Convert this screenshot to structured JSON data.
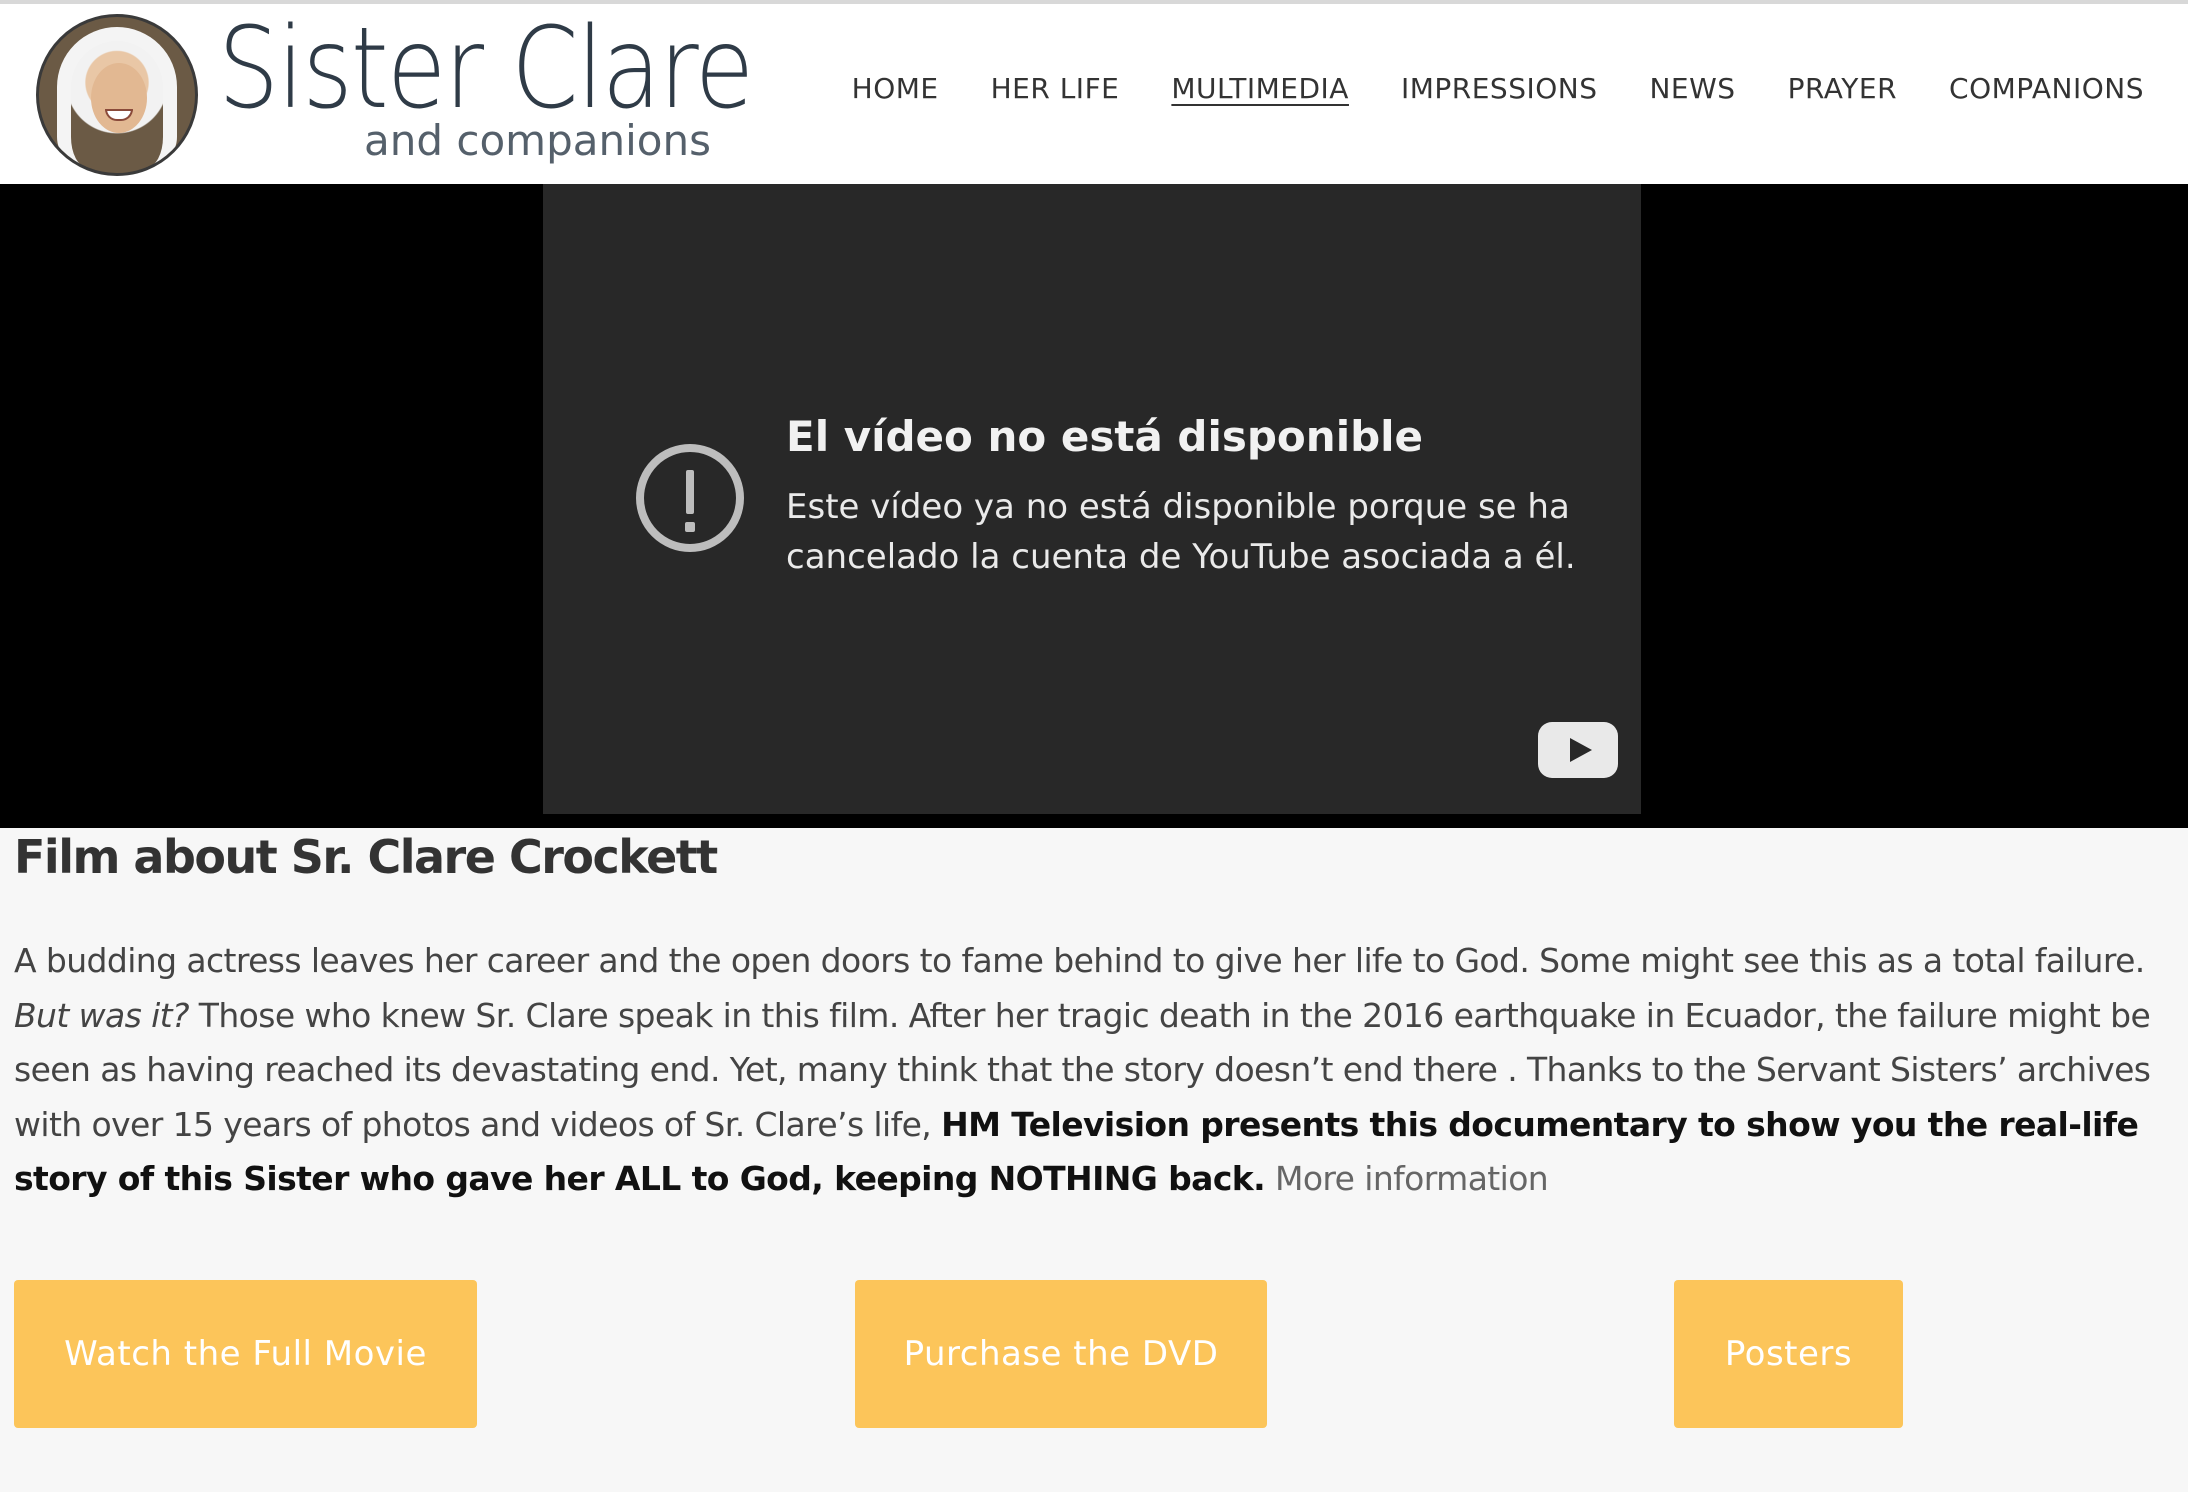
{
  "brand": {
    "title": "Sister Clare",
    "subtitle": "and companions"
  },
  "nav": {
    "items": [
      {
        "label": "HOME"
      },
      {
        "label": "HER LIFE"
      },
      {
        "label": "MULTIMEDIA",
        "active": true
      },
      {
        "label": "IMPRESSIONS"
      },
      {
        "label": "NEWS"
      },
      {
        "label": "PRAYER"
      },
      {
        "label": "COMPANIONS"
      }
    ]
  },
  "video": {
    "error_title": "El vídeo no está disponible",
    "error_message": "Este vídeo ya no está disponible porque se ha cancelado la cuenta de YouTube asociada a él."
  },
  "film": {
    "title": "Film about Sr. Clare Crockett",
    "desc_intro": "A budding actress leaves her career and the open doors to fame behind to give her life to God. Some might see this as a total failure. ",
    "desc_italic": "But was it?",
    "desc_middle": " Those who knew Sr. Clare speak in this film. After her tragic death in the 2016 earthquake in Ecuador, the failure might be seen as having reached its devastating end. Yet, many think that the story doesn’t end there . Thanks to the Servant Sisters’ archives with over 15 years of photos and videos of Sr. Clare’s life, ",
    "desc_bold": "HM Television presents this documentary to show you the real-life story of this Sister who gave her ALL to God, keeping NOTHING back.",
    "more_link": "More information"
  },
  "buttons": {
    "watch": "Watch the Full Movie",
    "dvd": "Purchase the DVD",
    "posters": "Posters"
  },
  "colors": {
    "button_bg": "#fcc55a",
    "player_bg": "#282828",
    "page_bg": "#f7f7f7"
  }
}
